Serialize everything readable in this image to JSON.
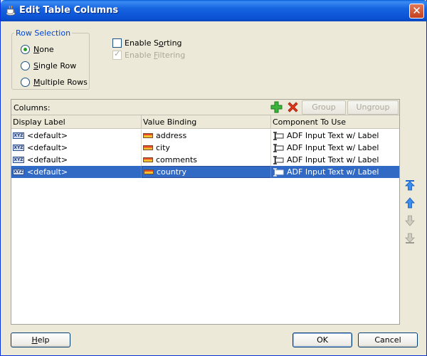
{
  "window": {
    "title": "Edit Table Columns",
    "close_label": "✕"
  },
  "row_selection": {
    "legend": "Row Selection",
    "options": [
      {
        "prefix": "",
        "mnemonic": "N",
        "rest": "one",
        "checked": true
      },
      {
        "prefix": "",
        "mnemonic": "S",
        "rest": "ingle Row",
        "checked": false
      },
      {
        "prefix": "",
        "mnemonic": "M",
        "rest": "ultiple Rows",
        "checked": false
      }
    ]
  },
  "options": {
    "sorting": {
      "prefix": "Enable S",
      "mnemonic": "o",
      "rest": "rting",
      "checked": false,
      "enabled": true
    },
    "filtering": {
      "prefix": "Enable ",
      "mnemonic": "F",
      "rest": "iltering",
      "checked": true,
      "enabled": false
    }
  },
  "columns_panel": {
    "label": "Columns:",
    "group_label": "Group",
    "ungroup_label": "Ungroup",
    "headers": [
      "Display Label",
      "Value Binding",
      "Component To Use"
    ],
    "rows": [
      {
        "display": "<default>",
        "binding": "address",
        "component": "ADF Input Text w/ Label",
        "selected": false
      },
      {
        "display": "<default>",
        "binding": "city",
        "component": "ADF Input Text w/ Label",
        "selected": false
      },
      {
        "display": "<default>",
        "binding": "comments",
        "component": "ADF Input Text w/ Label",
        "selected": false
      },
      {
        "display": "<default>",
        "binding": "country",
        "component": "ADF Input Text w/ Label",
        "selected": true
      }
    ]
  },
  "buttons": {
    "help_mnemonic": "H",
    "help_rest": "elp",
    "ok": "OK",
    "cancel": "Cancel"
  },
  "colors": {
    "selection": "#316ac5",
    "title_bar": "#0b52d3",
    "legend": "#0046d5"
  }
}
